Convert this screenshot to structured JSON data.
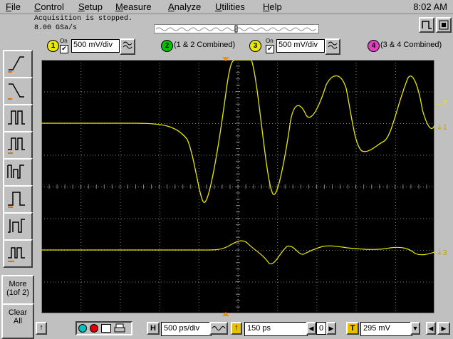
{
  "menu": {
    "items": [
      {
        "label": "File",
        "u": "F",
        "rest": "ile"
      },
      {
        "label": "Control",
        "u": "C",
        "rest": "ontrol"
      },
      {
        "label": "Setup",
        "u": "S",
        "rest": "etup"
      },
      {
        "label": "Measure",
        "u": "M",
        "rest": "easure"
      },
      {
        "label": "Analyze",
        "u": "A",
        "rest": "nalyze"
      },
      {
        "label": "Utilities",
        "u": "U",
        "rest": "tilities"
      },
      {
        "label": "Help",
        "u": "H",
        "rest": "elp"
      }
    ],
    "clock": "8:02 AM"
  },
  "status": {
    "line1": "Acquisition is stopped.",
    "line2": "8.00 GSa/s"
  },
  "channels": {
    "ch1": {
      "num": "1",
      "on_label": "On",
      "checked": "✔",
      "scale": "500 mV/div",
      "color": "#e8e800"
    },
    "ch2": {
      "num": "2",
      "label": "(1 & 2 Combined)",
      "color": "#00c000"
    },
    "ch3": {
      "num": "3",
      "on_label": "On",
      "checked": "✔",
      "scale": "500 mV/div",
      "color": "#e8e800"
    },
    "ch4": {
      "num": "4",
      "label": "(3 & 4 Combined)",
      "color": "#e040c0"
    }
  },
  "sidebar": {
    "more_label": "More",
    "more_page": "(1of 2)",
    "clear_label": "Clear",
    "clear_sub": "All"
  },
  "markers": {
    "trigger_level": "T",
    "ch1_marker": "1",
    "ch3_marker": "3"
  },
  "bottom": {
    "h_label": "H",
    "timebase": "500 ps/div",
    "delay": "150 ps",
    "delay_nav": "0",
    "trig_label": "T",
    "trig_level": "295 mV",
    "trig_icon": "↑"
  },
  "colors": {
    "trace": "#e8e800",
    "grid": "#808080",
    "background": "#000000",
    "marker": "#ff8c00"
  }
}
